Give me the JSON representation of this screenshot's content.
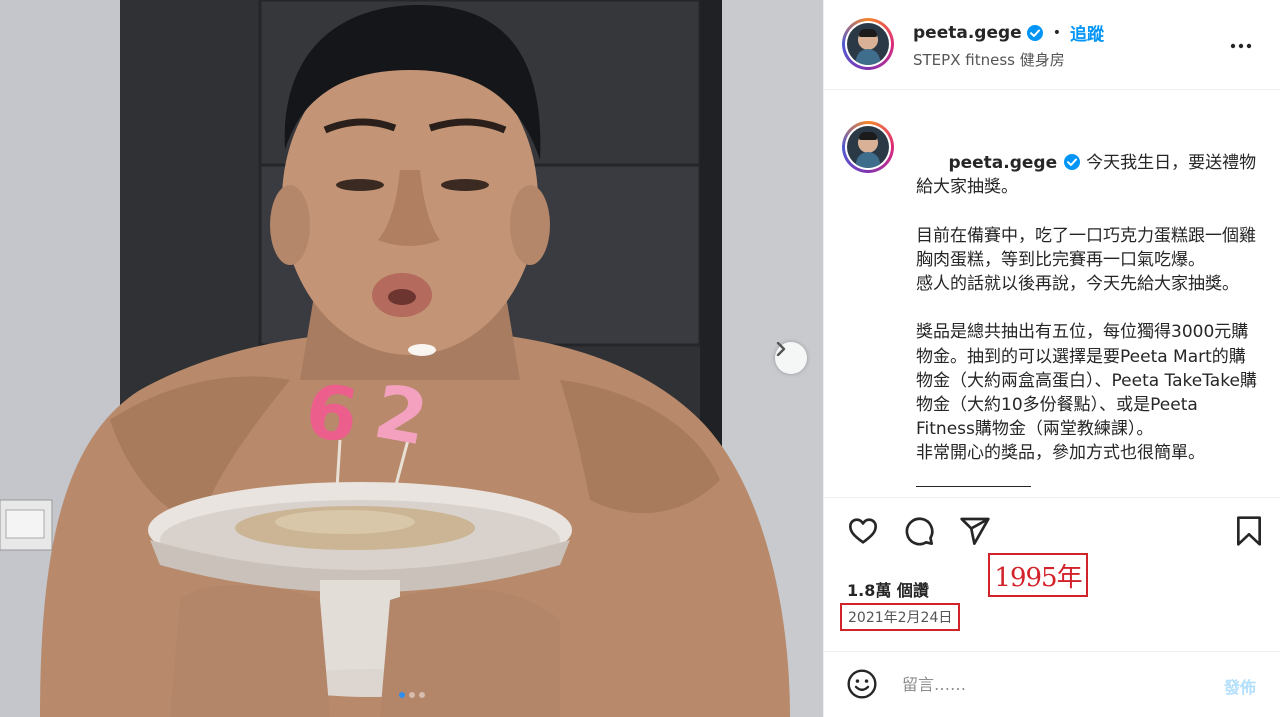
{
  "photo": {
    "candle_digits": [
      "2",
      "6"
    ],
    "carousel_count": 3,
    "carousel_active": 1
  },
  "post": {
    "username": "peeta.gege",
    "follow_label": "追蹤",
    "separator": "•",
    "location": "STEPX fitness 健身房",
    "caption_lines": [
      "今天我生日，要送禮物給大家抽獎。",
      "目前在備賽中，吃了一口巧克力蛋糕跟一個雞胸肉蛋糕，等到比完賽再一口氣吃爆。",
      "感人的話就以後再說，今天先給大家抽獎。",
      "",
      "獎品是總共抽出有五位，每位獨得3000元購物金。抽到的可以選擇是要Peeta Mart的購物金（大約兩盒高蛋白）、Peeta TakeTake購物金（大約10多份餐點）、或是Peeta Fitness購物金（兩堂教練課）。",
      "非常開心的獎品，參加方式也很簡單。"
    ],
    "likes": "1.8萬 個讚",
    "date": "2021年2月24日",
    "annotation": "1995年",
    "comment_placeholder": "留言……",
    "post_button": "發佈"
  },
  "colors": {
    "accent": "#0095f6",
    "annotation_red": "#d3232a",
    "post_disabled": "#b2dffc"
  }
}
